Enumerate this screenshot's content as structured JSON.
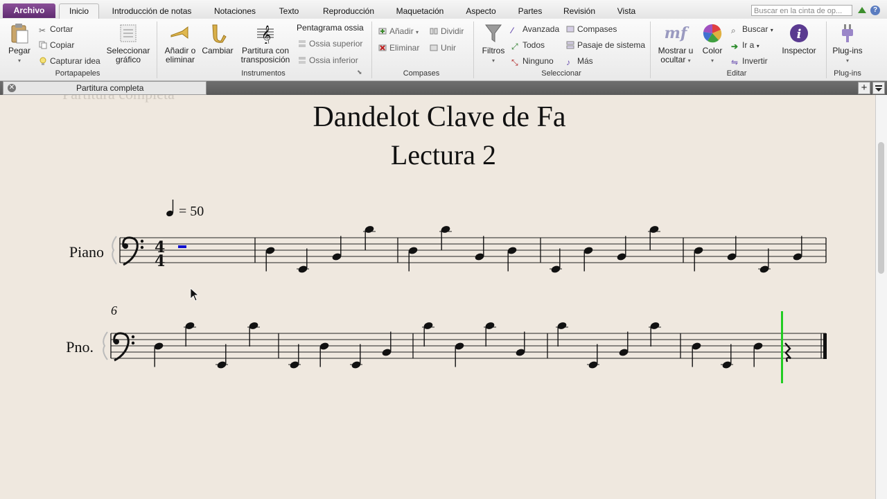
{
  "tabs": [
    "Archivo",
    "Inicio",
    "Introducción de notas",
    "Notaciones",
    "Texto",
    "Reproducción",
    "Maquetación",
    "Aspecto",
    "Partes",
    "Revisión",
    "Vista"
  ],
  "search_placeholder": "Buscar en la cinta de op...",
  "help_label": "?",
  "ribbon": {
    "portapapeles": {
      "label": "Portapapeles",
      "pegar": "Pegar",
      "cortar": "Cortar",
      "copiar": "Copiar",
      "capturar": "Capturar idea",
      "seleccionar1": "Seleccionar",
      "seleccionar2": "gráfico"
    },
    "instrumentos": {
      "label": "Instrumentos",
      "anadir1": "Añadir o",
      "anadir2": "eliminar",
      "cambiar": "Cambiar",
      "partitura1": "Partitura con",
      "partitura2": "transposición",
      "pentagrama": "Pentagrama ossia",
      "ossia_sup": "Ossia superior",
      "ossia_inf": "Ossia inferior"
    },
    "compases": {
      "label": "Compases",
      "anadir": "Añadir",
      "dividir": "Dividir",
      "eliminar": "Eliminar",
      "unir": "Unir"
    },
    "seleccionar": {
      "label": "Seleccionar",
      "filtros": "Filtros",
      "avanzada": "Avanzada",
      "todos": "Todos",
      "ninguno": "Ninguno",
      "compases": "Compases",
      "pasaje": "Pasaje de sistema",
      "mas": "Más"
    },
    "editar": {
      "label": "Editar",
      "mostrar1": "Mostrar u",
      "mostrar2": "ocultar",
      "color": "Color",
      "buscar": "Buscar",
      "ira": "Ir a",
      "invertir": "Invertir",
      "inspector": "Inspector",
      "mf": "mf"
    },
    "plugins": {
      "label": "Plug-ins",
      "plugins": "Plug-ins"
    }
  },
  "document_tab": {
    "close": "✕",
    "title": "Partitura completa"
  },
  "plus_label": "+",
  "score": {
    "ghost_title": "Partitura completa",
    "title": "Dandelot Clave de Fa",
    "subtitle": "Lectura 2",
    "tempo": "= 50",
    "timesig_top": "4",
    "timesig_bottom": "4",
    "instrument_full": "Piano",
    "instrument_short": "Pno.",
    "system2_measure_number": "6"
  },
  "colors": {
    "selection": "#1010d0",
    "playback_line": "#22cc22",
    "file_tab": "#6b3380"
  }
}
